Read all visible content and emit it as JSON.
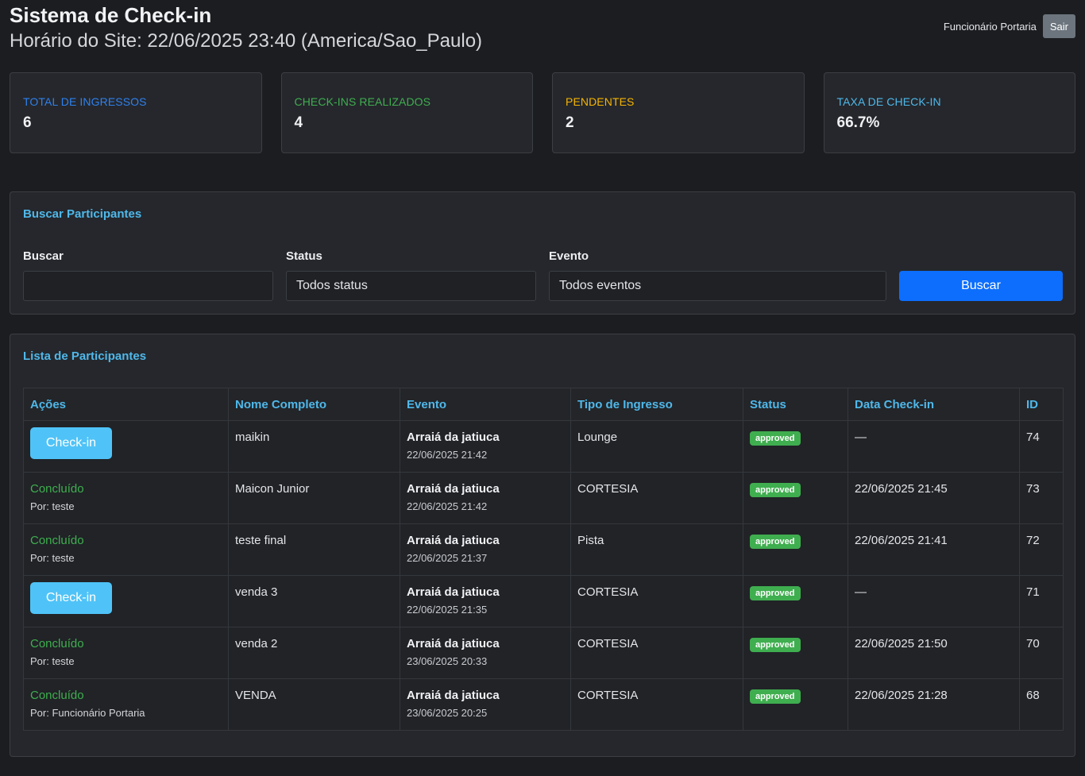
{
  "header": {
    "title": "Sistema de Check-in",
    "site_time": "Horário do Site: 22/06/2025 23:40 (America/Sao_Paulo)",
    "user_name": "Funcionário Portaria",
    "logout_label": "Sair"
  },
  "stats": [
    {
      "label": "TOTAL DE INGRESSOS",
      "value": "6",
      "color": "#2f80ed"
    },
    {
      "label": "CHECK-INS REALIZADOS",
      "value": "4",
      "color": "#3fae4f"
    },
    {
      "label": "PENDENTES",
      "value": "2",
      "color": "#f5b400"
    },
    {
      "label": "TAXA DE CHECK-IN",
      "value": "66.7%",
      "color": "#4fb8ea"
    }
  ],
  "search": {
    "title": "Buscar Participantes",
    "buscar_label": "Buscar",
    "buscar_value": "",
    "status_label": "Status",
    "status_value": "Todos status",
    "evento_label": "Evento",
    "evento_value": "Todos eventos",
    "submit_label": "Buscar"
  },
  "list": {
    "title": "Lista de Participantes",
    "columns": [
      "Ações",
      "Nome Completo",
      "Evento",
      "Tipo de Ingresso",
      "Status",
      "Data Check-in",
      "ID"
    ],
    "checkin_label": "Check-in",
    "rows": [
      {
        "done": false,
        "done_label": "",
        "by": "",
        "name": "maikin",
        "event": "Arraiá da jatiuca",
        "event_date": "22/06/2025 21:42",
        "ticket": "Lounge",
        "status": "approved",
        "checkin_at": "—",
        "id": "74"
      },
      {
        "done": true,
        "done_label": "Concluído",
        "by": "Por: teste",
        "name": "Maicon Junior",
        "event": "Arraiá da jatiuca",
        "event_date": "22/06/2025 21:42",
        "ticket": "CORTESIA",
        "status": "approved",
        "checkin_at": "22/06/2025 21:45",
        "id": "73"
      },
      {
        "done": true,
        "done_label": "Concluído",
        "by": "Por: teste",
        "name": "teste final",
        "event": "Arraiá da jatiuca",
        "event_date": "22/06/2025 21:37",
        "ticket": "Pista",
        "status": "approved",
        "checkin_at": "22/06/2025 21:41",
        "id": "72"
      },
      {
        "done": false,
        "done_label": "",
        "by": "",
        "name": "venda 3",
        "event": "Arraiá da jatiuca",
        "event_date": "22/06/2025 21:35",
        "ticket": "CORTESIA",
        "status": "approved",
        "checkin_at": "—",
        "id": "71"
      },
      {
        "done": true,
        "done_label": "Concluído",
        "by": "Por: teste",
        "name": "venda 2",
        "event": "Arraiá da jatiuca",
        "event_date": "23/06/2025 20:33",
        "ticket": "CORTESIA",
        "status": "approved",
        "checkin_at": "22/06/2025 21:50",
        "id": "70"
      },
      {
        "done": true,
        "done_label": "Concluído",
        "by": "Por: Funcionário Portaria",
        "name": "VENDA",
        "event": "Arraiá da jatiuca",
        "event_date": "23/06/2025 20:25",
        "ticket": "CORTESIA",
        "status": "approved",
        "checkin_at": "22/06/2025 21:28",
        "id": "68"
      }
    ]
  }
}
